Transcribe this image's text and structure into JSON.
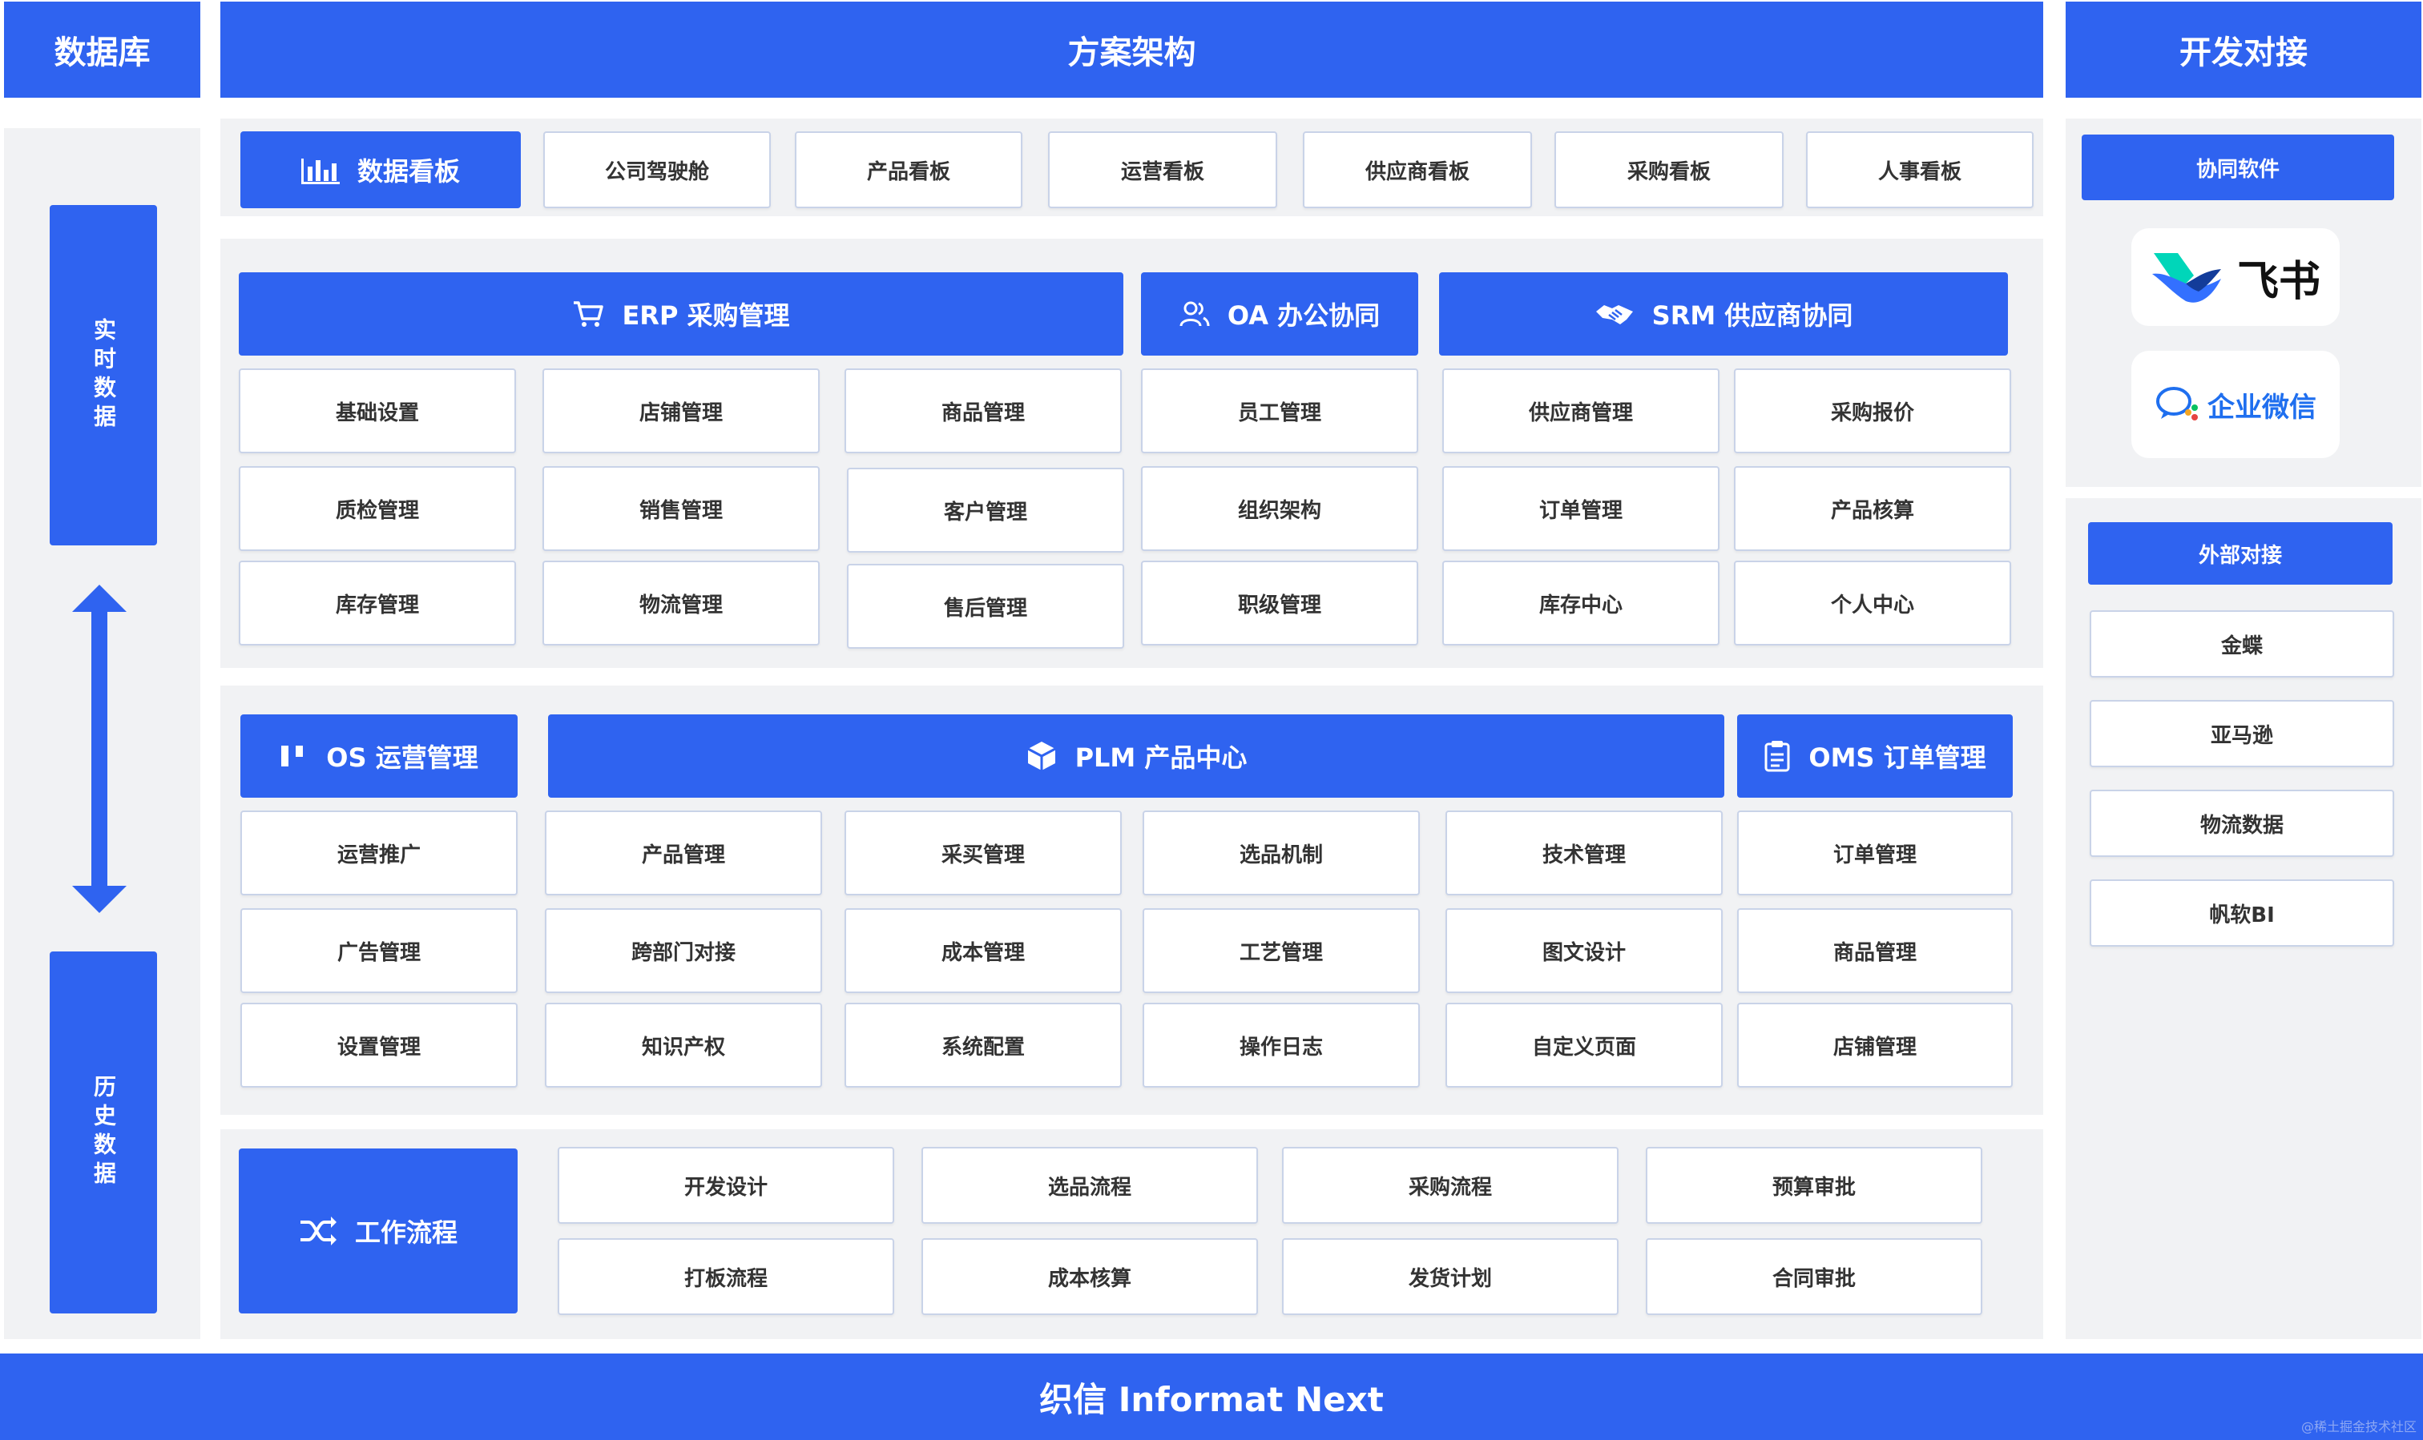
{
  "headers": {
    "database": "数据库",
    "architecture": "方案架构",
    "dev": "开发对接"
  },
  "left": {
    "realtime": "实时数据",
    "history": "历史数据"
  },
  "dashboards": {
    "title": "数据看板",
    "items": [
      "公司驾驶舱",
      "产品看板",
      "运营看板",
      "供应商看板",
      "采购看板",
      "人事看板"
    ]
  },
  "erp": {
    "title": "ERP 采购管理",
    "items": [
      "基础设置",
      "店铺管理",
      "商品管理",
      "质检管理",
      "销售管理",
      "客户管理",
      "库存管理",
      "物流管理",
      "售后管理"
    ]
  },
  "oa": {
    "title": "OA 办公协同",
    "items": [
      "员工管理",
      "组织架构",
      "职级管理"
    ]
  },
  "srm": {
    "title": "SRM 供应商协同",
    "items": [
      "供应商管理",
      "采购报价",
      "订单管理",
      "产品核算",
      "库存中心",
      "个人中心"
    ]
  },
  "os": {
    "title": "OS 运营管理",
    "items": [
      "运营推广",
      "广告管理",
      "设置管理"
    ]
  },
  "plm": {
    "title": "PLM 产品中心",
    "items": [
      "产品管理",
      "采买管理",
      "选品机制",
      "技术管理",
      "跨部门对接",
      "成本管理",
      "工艺管理",
      "图文设计",
      "知识产权",
      "系统配置",
      "操作日志",
      "自定义页面"
    ]
  },
  "oms": {
    "title": "OMS 订单管理",
    "items": [
      "订单管理",
      "商品管理",
      "店铺管理"
    ]
  },
  "workflow": {
    "title": "工作流程",
    "items": [
      "开发设计",
      "选品流程",
      "采购流程",
      "预算审批",
      "打板流程",
      "成本核算",
      "发货计划",
      "合同审批"
    ]
  },
  "right": {
    "collab_title": "协同软件",
    "feishu": "飞书",
    "wecom": "企业微信",
    "external_title": "外部对接",
    "external_items": [
      "金蝶",
      "亚马逊",
      "物流数据",
      "帆软BI"
    ]
  },
  "footer": "织信 Informat Next",
  "watermark": "@稀土掘金技术社区",
  "colors": {
    "accent": "#2f63f0",
    "panel": "#f1f2f4",
    "cell_border": "#c9d3e8"
  }
}
